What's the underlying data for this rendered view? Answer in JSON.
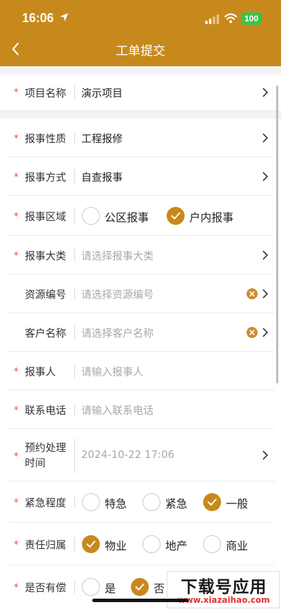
{
  "status_bar": {
    "time": "16:06",
    "battery": "100"
  },
  "nav": {
    "title": "工单提交"
  },
  "fields": {
    "project": {
      "label": "项目名称",
      "value": "演示项目"
    },
    "nature": {
      "label": "报事性质",
      "value": "工程报修"
    },
    "method": {
      "label": "报事方式",
      "value": "自查报事"
    },
    "area": {
      "label": "报事区域",
      "options": [
        "公区报事",
        "户内报事"
      ],
      "selected": "户内报事"
    },
    "category": {
      "label": "报事大类",
      "placeholder": "请选择报事大类"
    },
    "resource": {
      "label": "资源编号",
      "placeholder": "请选择资源编号"
    },
    "customer": {
      "label": "客户名称",
      "placeholder": "请选择客户名称"
    },
    "reporter": {
      "label": "报事人",
      "placeholder": "请输入报事人"
    },
    "phone": {
      "label": "联系电话",
      "placeholder": "请输入联系电话"
    },
    "appointment": {
      "label_line1": "预约处理",
      "label_line2": "时间",
      "value": "2024-10-22 17:06"
    },
    "urgency": {
      "label": "紧急程度",
      "options": [
        "特急",
        "紧急",
        "一般"
      ],
      "selected": "一般"
    },
    "responsibility": {
      "label": "责任归属",
      "options": [
        "物业",
        "地产",
        "商业"
      ],
      "selected": "物业"
    },
    "paid": {
      "label": "是否有偿",
      "options": [
        "是",
        "否"
      ],
      "selected": "否"
    }
  },
  "required_mark": "*",
  "watermark": {
    "title": "下载号应用",
    "url": "www.xiazaihao.com"
  },
  "colors": {
    "accent": "#C8891C",
    "required": "#E25A3A",
    "placeholder": "#A8A8A8"
  }
}
